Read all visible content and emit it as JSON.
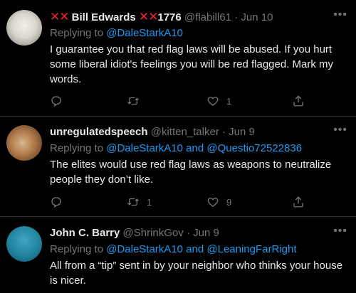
{
  "tweets": [
    {
      "name": "Bill Edwards",
      "name_suffix": "1776",
      "handle": "@flabill61",
      "time": "Jun 10",
      "replying_prefix": "Replying to",
      "mentions": [
        "@DaleStarkA10"
      ],
      "text": "I guarantee you that red flag laws will be abused. If you hurt some liberal idiot's feelings you will be red flagged. Mark my words.",
      "retweets": "",
      "likes": "1"
    },
    {
      "name": "unregulatedspeech",
      "handle": "@kitten_talker",
      "time": "Jun 9",
      "replying_prefix": "Replying to",
      "mentions": [
        "@DaleStarkA10",
        "@Questio72522836"
      ],
      "joiner": "and",
      "text": "The elites would use red flag laws as weapons to neutralize people they don’t like.",
      "retweets": "1",
      "likes": "9"
    },
    {
      "name": "John C. Barry",
      "handle": "@ShrinkGov",
      "time": "Jun 9",
      "replying_prefix": "Replying to",
      "mentions": [
        "@DaleStarkA10",
        "@LeaningFarRight"
      ],
      "joiner": "and",
      "text": "All from a “tip” sent in by your neighbor who thinks your house is nicer."
    }
  ],
  "icons": {
    "cross_marks": "✕✕",
    "reply": "reply-icon",
    "retweet": "retweet-icon",
    "like": "heart-icon",
    "share": "share-icon",
    "more": "more-icon"
  },
  "colors": {
    "accent": "#1d9bf0",
    "cross": "#f4212e",
    "muted": "#71767b",
    "text": "#e7e9ea",
    "background": "#000000"
  }
}
